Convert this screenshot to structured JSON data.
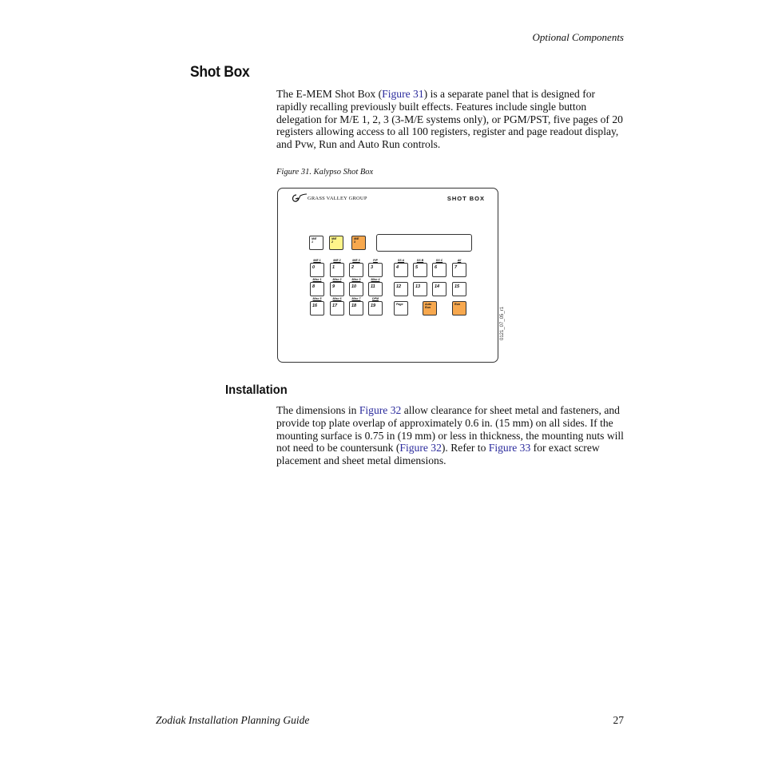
{
  "header": {
    "section": "Optional Components"
  },
  "shot_box": {
    "heading": "Shot Box",
    "para_parts": [
      "The E-MEM Shot Box (",
      "Figure 31",
      ") is a separate panel that is designed for rapidly recalling previously built effects. Features include single button delegation for M/E 1, 2, 3 (3-M/E systems only), or PGM/PST, five pages of 20 registers allowing access to all 100 registers, register and page readout display, and Pvw, Run and Auto Run controls."
    ],
    "figure_caption": "Figure 31.  Kalypso Shot Box"
  },
  "figure": {
    "logo_text": "GRASS VALLEY GROUP",
    "panel_title": "SHOT BOX",
    "figure_id": "0121_07_05_r1",
    "colors": {
      "yellow": "#fff58a",
      "orange": "#f7a84e"
    },
    "delegation_keys": [
      {
        "label": "M/E 1",
        "color": "white"
      },
      {
        "label": "M/E 2",
        "color": "yellow"
      },
      {
        "label": "M/E 3",
        "color": "orange"
      }
    ],
    "register_rows": [
      {
        "labels": [
          "M/E 1",
          "M/E 2",
          "M/E 3",
          "P/P",
          "SS A",
          "SS B",
          "SS C",
          "All"
        ],
        "keys": [
          "0",
          "1",
          "2",
          "3",
          "4",
          "5",
          "6",
          "7"
        ]
      },
      {
        "labels": [
          "Misc 1",
          "Misc 2",
          "Misc 3",
          "Misc 4",
          "",
          "",
          "",
          ""
        ],
        "keys": [
          "8",
          "9",
          "10",
          "11",
          "12",
          "13",
          "14",
          "15"
        ]
      },
      {
        "labels": [
          "Misc 5",
          "Misc 6",
          "Misc 7",
          "DPM",
          "",
          "",
          "",
          ""
        ],
        "keys": [
          "16",
          "17",
          "18",
          "19"
        ]
      }
    ],
    "control_keys": [
      {
        "label": "Page",
        "color": "white"
      },
      {
        "label": "Auto Run",
        "color": "orange"
      },
      {
        "label": "Run",
        "color": "orange"
      }
    ]
  },
  "installation": {
    "heading": "Installation",
    "para_parts": [
      "The dimensions in ",
      "Figure 32",
      " allow clearance for sheet metal and fasteners, and provide top plate overlap of approximately 0.6 in. (15 mm) on all sides. If the mounting surface is 0.75 in (19 mm) or less in thickness, the mounting nuts will not need to be countersunk (",
      "Figure 32",
      "). Refer to ",
      "Figure 33",
      " for exact screw placement and sheet metal dimensions."
    ]
  },
  "footer": {
    "title": "Zodiak Installation Planning Guide",
    "page": "27"
  }
}
